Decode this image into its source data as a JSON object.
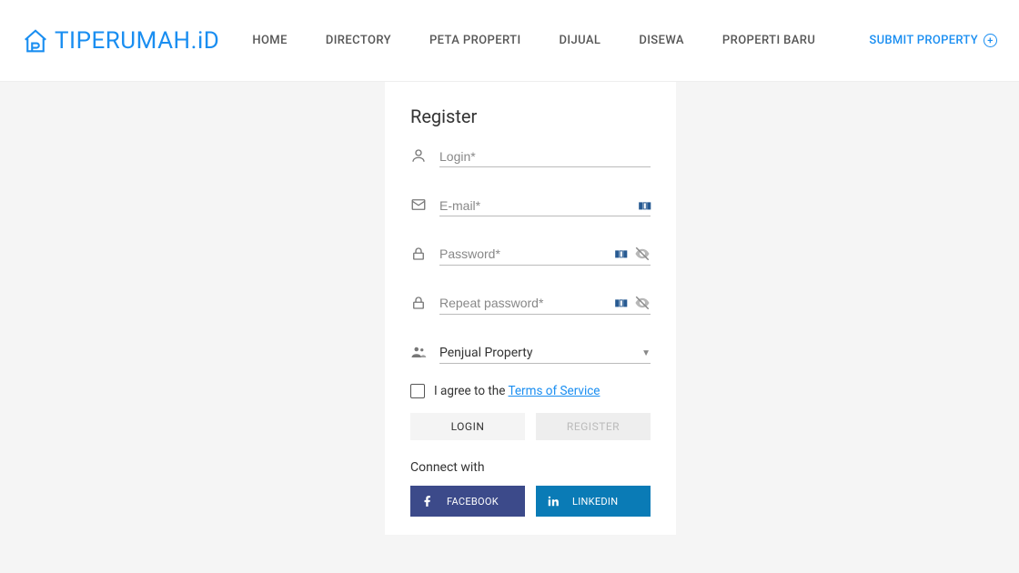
{
  "brand": {
    "name": "TIPERUMAH.iD"
  },
  "nav": {
    "items": [
      "HOME",
      "DIRECTORY",
      "PETA PROPERTI",
      "DIJUAL",
      "DISEWA",
      "PROPERTI BARU"
    ],
    "submit": "SUBMIT PROPERTY"
  },
  "card": {
    "title": "Register",
    "login_ph": "Login*",
    "email_ph": "E-mail*",
    "password_ph": "Password*",
    "repeat_ph": "Repeat password*",
    "role_selected": "Penjual Property",
    "terms_prefix": "I agree to the ",
    "terms_link": "Terms of Service",
    "login_btn": "LOGIN",
    "register_btn": "REGISTER",
    "connect_label": "Connect with",
    "facebook": "FACEBOOK",
    "linkedin": "LINKEDIN"
  }
}
